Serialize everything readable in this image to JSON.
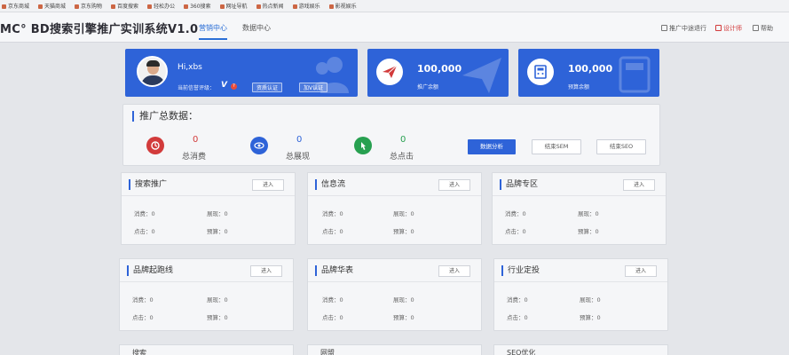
{
  "bookmarks": [
    "京东商城",
    "天猫商城",
    "京东购物",
    "百度搜索",
    "轻松办公",
    "360搜索",
    "网址导航",
    "热点新闻",
    "游戏娱乐",
    "影视娱乐"
  ],
  "header": {
    "brand": "MC° BD搜索引擎推广实训系统V1.0",
    "tabs": [
      "营销中心",
      "数据中心"
    ],
    "links": [
      "推广中途退行",
      "设计师",
      "帮助"
    ]
  },
  "profile": {
    "greeting": "Hi,xbs",
    "level_label": "当前信誉评级：",
    "level_badge": "V",
    "level_mark": "?",
    "btn_verify": "资质认证",
    "btn_addv": "加V认证"
  },
  "stats": [
    {
      "value": "100,000",
      "label": "推广余额",
      "icon": "paper-plane-icon"
    },
    {
      "value": "100,000",
      "label": "预算余额",
      "icon": "budget-calculator-icon"
    }
  ],
  "summary": {
    "title": "推广总数据：",
    "metrics": [
      {
        "value": "0",
        "label": "总消费",
        "icon": "spend-icon",
        "color": "#d23b3b"
      },
      {
        "value": "0",
        "label": "总展现",
        "icon": "eye-icon",
        "color": "#2e63d8"
      },
      {
        "value": "0",
        "label": "总点击",
        "icon": "click-icon",
        "color": "#27a050"
      }
    ],
    "buttons": [
      "数据分析",
      "结束SEM",
      "结束SEO"
    ]
  },
  "panels": [
    {
      "title": "搜索推广",
      "enter": "进入",
      "spend_label": "消费：0",
      "impr_label": "展现：0",
      "click_label": "点击：0",
      "budget_label": "预算：0"
    },
    {
      "title": "信息流",
      "enter": "进入",
      "spend_label": "消费：0",
      "impr_label": "展现：0",
      "click_label": "点击：0",
      "budget_label": "预算：0"
    },
    {
      "title": "品牌专区",
      "enter": "进入",
      "spend_label": "消费：0",
      "impr_label": "展现：0",
      "click_label": "点击：0",
      "budget_label": "预算：0"
    },
    {
      "title": "品牌起跑线",
      "enter": "进入",
      "spend_label": "消费：0",
      "impr_label": "展现：0",
      "click_label": "点击：0",
      "budget_label": "预算：0"
    },
    {
      "title": "品牌华表",
      "enter": "进入",
      "spend_label": "消费：0",
      "impr_label": "展现：0",
      "click_label": "点击：0",
      "budget_label": "预算：0"
    },
    {
      "title": "行业定投",
      "enter": "进入",
      "spend_label": "消费：0",
      "impr_label": "展现：0",
      "click_label": "点击：0",
      "budget_label": "预算：0"
    }
  ],
  "bottom_row": [
    "搜索",
    "网盟",
    "SEO优化"
  ]
}
